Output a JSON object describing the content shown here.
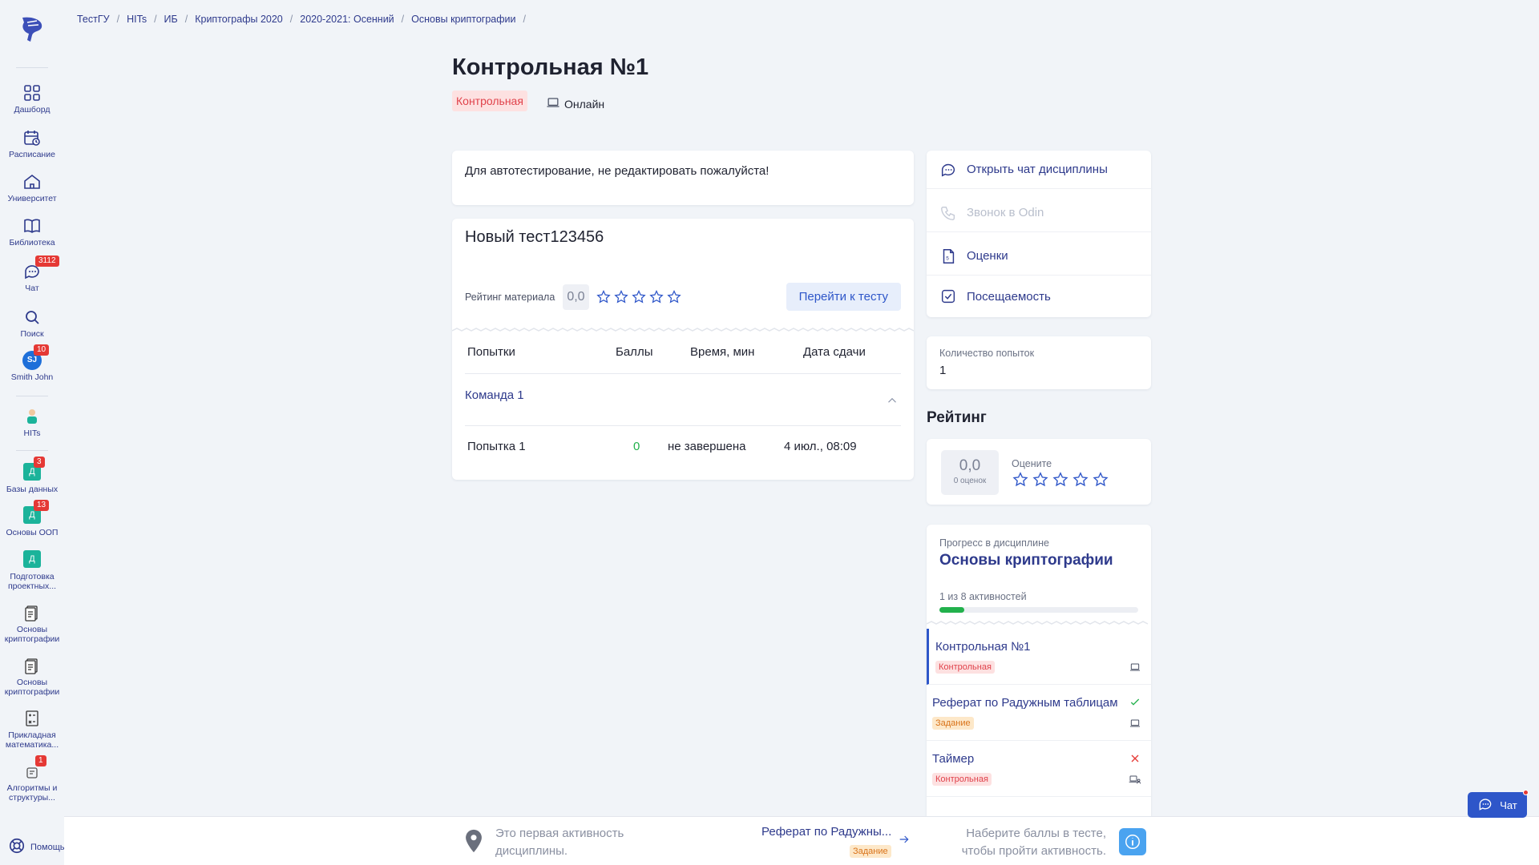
{
  "breadcrumb": [
    "ТестГУ",
    "HITs",
    "ИБ",
    "Криптографы 2020",
    "2020-2021: Осенний",
    "Основы криптографии"
  ],
  "sidebar": {
    "items": [
      {
        "label": "Дашборд",
        "icon": "dashboard-icon"
      },
      {
        "label": "Расписание",
        "icon": "calendar-icon"
      },
      {
        "label": "Университет",
        "icon": "university-icon"
      },
      {
        "label": "Библиотека",
        "icon": "book-icon"
      },
      {
        "label": "Чат",
        "icon": "chat-icon",
        "badge": "3112"
      },
      {
        "label": "Поиск",
        "icon": "search-icon"
      },
      {
        "label": "Smith John",
        "avatar": "SJ",
        "badge": "10"
      },
      {
        "label": "HITs",
        "icon": "hits-logo-icon"
      }
    ],
    "courses": [
      {
        "label": "Базы данных",
        "letter": "Д",
        "badge": "3"
      },
      {
        "label": "Основы ООП",
        "letter": "Д",
        "badge": "13"
      },
      {
        "label": "Подготовка проектных...",
        "letter": "Д"
      },
      {
        "label": "Основы криптографии",
        "icon": "course-doc-icon"
      },
      {
        "label": "Основы криптографии",
        "icon": "course-doc-icon"
      },
      {
        "label": "Прикладная математика...",
        "icon": "course-math-icon"
      },
      {
        "label": "Алгоритмы и структуры...",
        "icon": "course-algo-icon",
        "badge": "1"
      }
    ],
    "help": "Помощь"
  },
  "page": {
    "title": "Контрольная №1",
    "type": "Контрольная",
    "mode": "Онлайн",
    "description": "Для автотестирование, не редактировать пожалуйста!"
  },
  "test": {
    "title": "Новый тест123456",
    "rating_label": "Рейтинг материала",
    "rating_value": "0,0",
    "go_button": "Перейти к тесту",
    "columns": [
      "Попытки",
      "Баллы",
      "Время, мин",
      "Дата сдачи"
    ],
    "team": "Команда 1",
    "rows": [
      {
        "attempt": "Попытка 1",
        "score": "0",
        "time": "не завершена",
        "date": "4 июл., 08:09"
      }
    ]
  },
  "actions": [
    {
      "label": "Открыть чат дисциплины",
      "icon": "chat-icon",
      "enabled": true
    },
    {
      "label": "Звонок в Odin",
      "icon": "phone-icon",
      "enabled": false
    },
    {
      "label": "Оценки",
      "icon": "grades-icon",
      "enabled": true
    },
    {
      "label": "Посещаемость",
      "icon": "attendance-icon",
      "enabled": true
    }
  ],
  "attempts": {
    "label": "Количество попыток",
    "value": "1"
  },
  "rating": {
    "heading": "Рейтинг",
    "value": "0,0",
    "count": "0 оценок",
    "rate_label": "Оцените"
  },
  "progress": {
    "label": "Прогресс в дисциплине",
    "course": "Основы криптографии",
    "count_text": "1 из 8 активностей",
    "fraction": 0.125,
    "activities": [
      {
        "name": "Контрольная №1",
        "tag": "Контрольная",
        "tag_color": "red",
        "active": true,
        "status": "",
        "mode_icon": "laptop-icon"
      },
      {
        "name": "Реферат по Радужным таблицам",
        "tag": "Задание",
        "tag_color": "orange",
        "status": "check-icon",
        "mode_icon": "laptop-icon"
      },
      {
        "name": "Таймер",
        "tag": "Контрольная",
        "tag_color": "red",
        "status": "cross-icon",
        "mode_icon": "hybrid-icon"
      }
    ]
  },
  "bottom": {
    "first_text": "Это первая активность дисциплины.",
    "next_name": "Реферат по Радужны...",
    "next_tag": "Задание",
    "hint": "Наберите баллы в тесте, чтобы пройти активность."
  },
  "chat_fab": "Чат",
  "colors": {
    "accent": "#2e56c9",
    "nav": "#2e3a8c",
    "success": "#22b14c",
    "danger": "#e53935"
  }
}
